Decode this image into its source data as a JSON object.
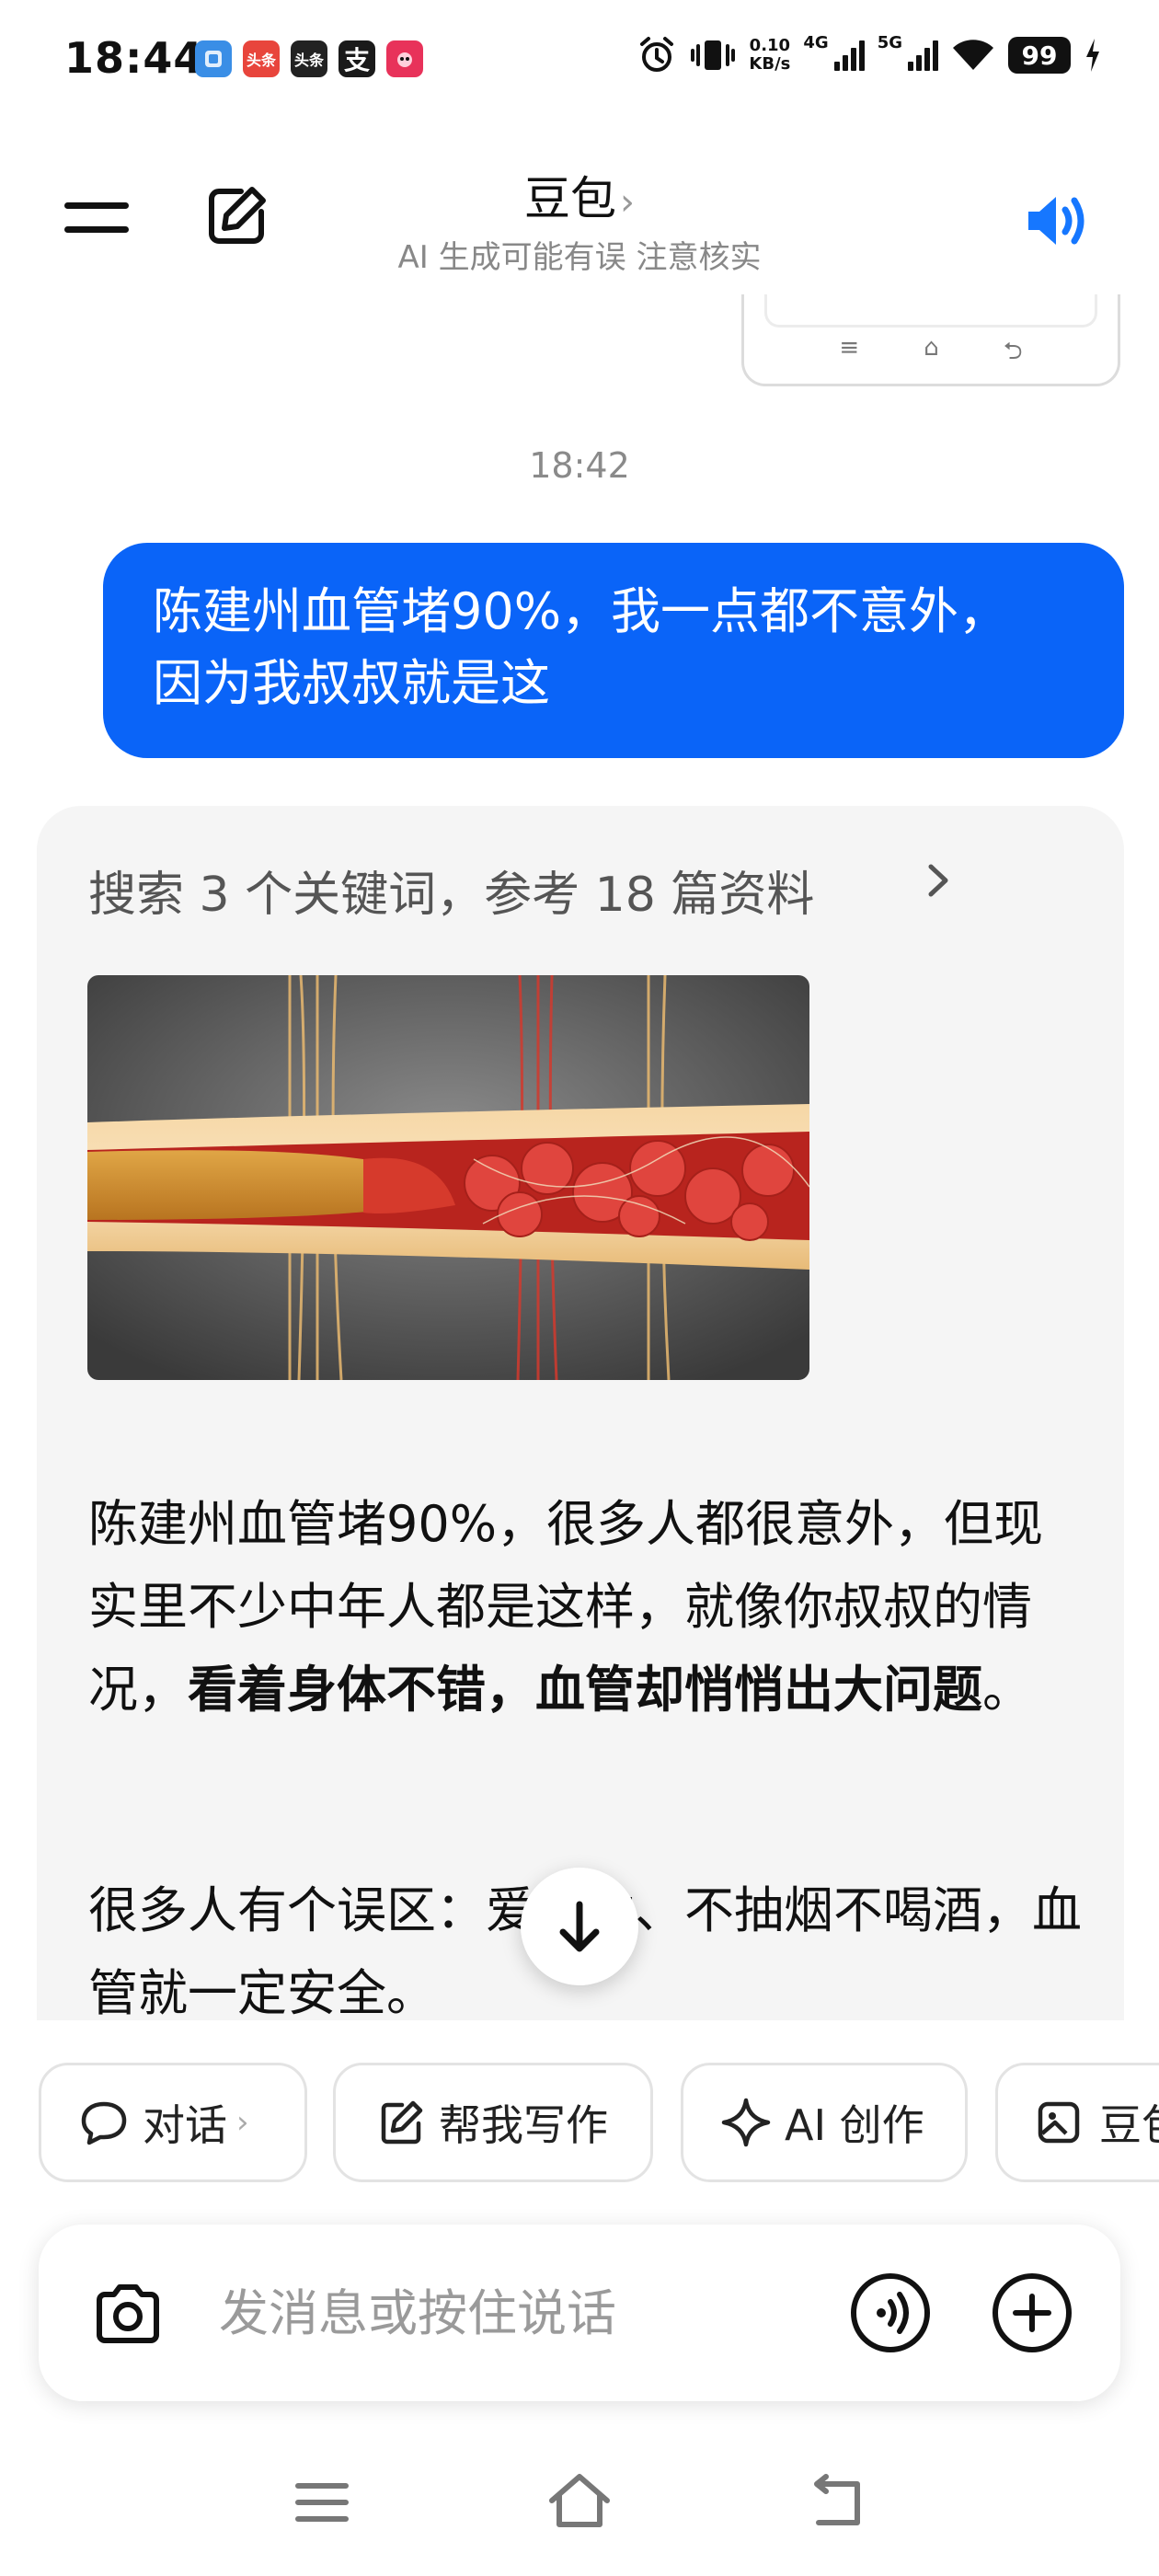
{
  "status_bar": {
    "time": "18:44",
    "notif_icons": [
      {
        "name": "app-icon-1",
        "text": "",
        "color": "#3a8ee6"
      },
      {
        "name": "toutiao-app-icon",
        "text": "头条",
        "color": "#e8453c"
      },
      {
        "name": "toutiao-app-icon-2",
        "text": "头条",
        "color": "#222222"
      },
      {
        "name": "alipay-app-icon",
        "text": "支",
        "color": "#1677ff"
      },
      {
        "name": "douyin-app-icon",
        "text": "",
        "color": "#e8325a"
      }
    ],
    "net_speed_value": "0.10",
    "net_speed_unit": "KB/s",
    "signal_4g": "4G",
    "signal_5g": "5G",
    "battery": "99"
  },
  "header": {
    "title": "豆包",
    "title_chevron": "›",
    "subtitle": "AI 生成可能有误 注意核实"
  },
  "timestamp": "18:42",
  "user_message": {
    "line1": "陈建州血管堵90%，我一点都不意外，",
    "line2": "因为我叔叔就是这"
  },
  "ai_message": {
    "search_ref": "搜索 3 个关键词，参考 18 篇资料",
    "image_alt": "blocked blood vessel illustration",
    "p1_normal": "陈建州血管堵90%，很多人都很意外，但现实里不少中年人都是这样，就像你叔叔的情况，",
    "p1_bold": "看着身体不错，血管却悄悄出大问题",
    "p1_end": "。",
    "p2": "很多人有个误区：爱运动、不抽烟不喝酒，血管就一定安全。"
  },
  "quick_actions": [
    {
      "label": "对话",
      "chevron": "›",
      "icon": "chat-bubble-icon"
    },
    {
      "label": "帮我写作",
      "icon": "pen-square-icon"
    },
    {
      "label": "AI 创作",
      "icon": "sparkle-icon"
    },
    {
      "label": "豆包",
      "icon": "image-edit-icon"
    }
  ],
  "input": {
    "placeholder": "发消息或按住说话"
  },
  "colors": {
    "accent": "#0a64f8",
    "card_bg": "#f5f5f5"
  }
}
